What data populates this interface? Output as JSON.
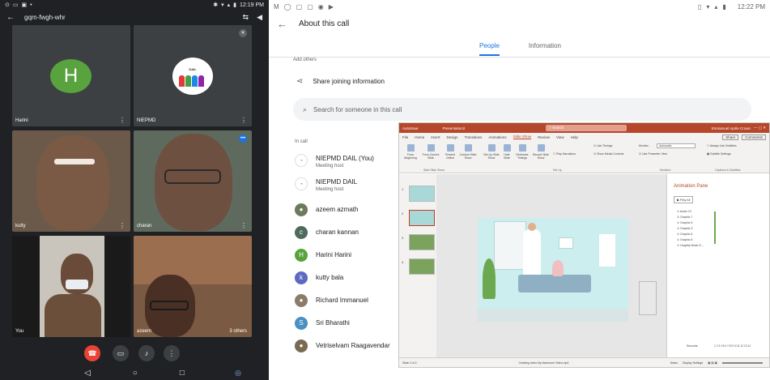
{
  "phone": {
    "status": {
      "time": "12:19 PM"
    },
    "meeting_code": "gqm-fwgh-whr",
    "tiles": [
      {
        "name": "Harini",
        "initial": "H",
        "color": "#58a33d"
      },
      {
        "name": "NIEPMD",
        "logo_text": "DAIL"
      },
      {
        "name": "kutty"
      },
      {
        "name": "charan"
      },
      {
        "name": "You"
      },
      {
        "name": "azeem",
        "badge": "3 others"
      }
    ],
    "controls": [
      "end-call",
      "camera",
      "microphone",
      "more"
    ]
  },
  "tablet": {
    "status": {
      "time": "12:22 PM"
    },
    "title": "About this call",
    "tabs": [
      {
        "label": "People",
        "active": true
      },
      {
        "label": "Information",
        "active": false
      }
    ],
    "add_others": "Add others",
    "share_label": "Share joining information",
    "search_placeholder": "Search for someone in this call",
    "in_call_label": "In call",
    "people": [
      {
        "name": "NIEPMD DAIL (You)",
        "sub": "Meeting host",
        "avatar_type": "logo"
      },
      {
        "name": "NIEPMD DAIL",
        "sub": "Meeting host",
        "avatar_type": "logo"
      },
      {
        "name": "azeem azmath",
        "avatar_type": "photo",
        "color": "#6d7a5c"
      },
      {
        "name": "charan kannan",
        "initial": "c",
        "color": "#4e6b5e"
      },
      {
        "name": "Harini Harini",
        "initial": "H",
        "color": "#58a33d"
      },
      {
        "name": "kutty bala",
        "initial": "k",
        "color": "#5c6bc0"
      },
      {
        "name": "Richard Immanuel",
        "avatar_type": "photo",
        "color": "#8d7b6a"
      },
      {
        "name": "Sri Bharathi",
        "initial": "S",
        "color": "#4a90c2"
      },
      {
        "name": "Vetriselvam Raagavendar",
        "avatar_type": "photo",
        "color": "#7a6a52"
      }
    ]
  },
  "ppt": {
    "autosave": "AutoSave",
    "file": "Presentation2",
    "search": "Search",
    "user": "Emmanuel Aprile Crown",
    "tabs": [
      "File",
      "Home",
      "Insert",
      "Design",
      "Transitions",
      "Animations",
      "Slide Show",
      "Review",
      "View",
      "Help"
    ],
    "active_tab": "Slide Show",
    "share": "Share",
    "comments": "Comments",
    "ribbon": {
      "from_beginning": "From Beginning",
      "from_current": "From Current Slide",
      "present_online": "Present Online",
      "custom_show": "Custom Slide Show",
      "setup_show": "Set Up Slide Show",
      "hide_slide": "Hide Slide",
      "rehearse": "Rehearse Timings",
      "record": "Record Slide Show",
      "play_narrations": "Play Narrations",
      "use_timings": "Use Timings",
      "show_media": "Show Media Controls",
      "group_start": "Start Slide Show",
      "group_setup": "Set Up",
      "group_monitors": "Monitors",
      "group_captions": "Captions & Subtitles",
      "monitor_label": "Monitor:",
      "monitor_value": "Automatic",
      "presenter_view": "Use Presenter View",
      "always_subtitles": "Always Use Subtitles",
      "subtitle_settings": "Subtitle Settings"
    },
    "anim_pane": {
      "title": "Animation Pane",
      "play_all": "Play All",
      "items": [
        "Audio 13",
        "Graphic 7",
        "Graphic 5",
        "Graphic 3",
        "Graphic 6",
        "Graphic 8",
        "Hospital Heart O..."
      ],
      "seconds": "Seconds",
      "timeline": "1 2 3 4 5 6 7 8 9 10 11 12 13 14"
    },
    "status": {
      "slide": "Slide 2 of 4",
      "note": "Creating video My Awesome Video.mp4",
      "notes": "Notes",
      "display": "Display Settings"
    }
  }
}
